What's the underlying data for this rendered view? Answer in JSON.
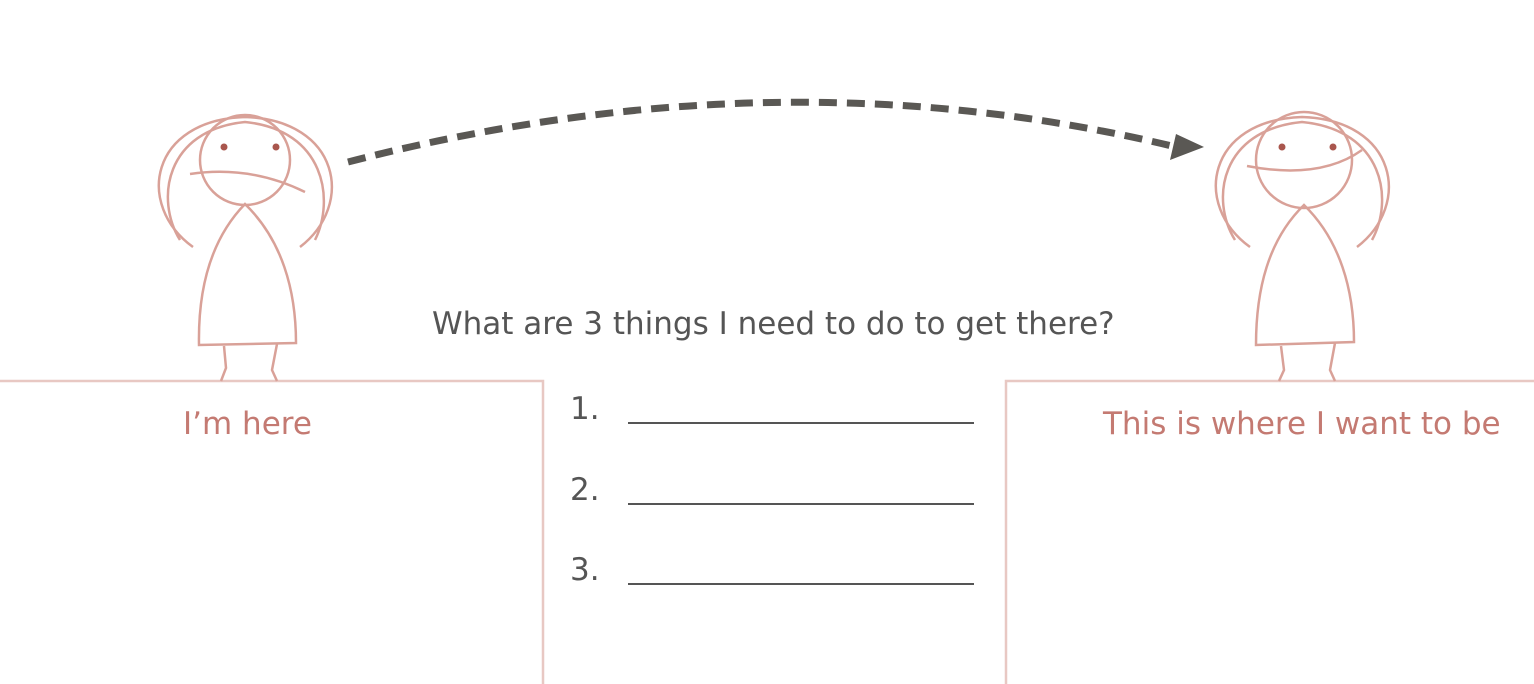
{
  "question": "What are 3 things I need to do to get there?",
  "left_label": "I’m here",
  "right_label": "This is where I want to be",
  "steps": [
    {
      "number": "1.",
      "answer": ""
    },
    {
      "number": "2.",
      "answer": ""
    },
    {
      "number": "3.",
      "answer": ""
    }
  ],
  "colors": {
    "figure": "#d9a198",
    "eyes": "#a9564d",
    "label": "#c47a72",
    "cliff": "#e8c8c3",
    "arrow": "#5a5854",
    "text": "#555555"
  }
}
